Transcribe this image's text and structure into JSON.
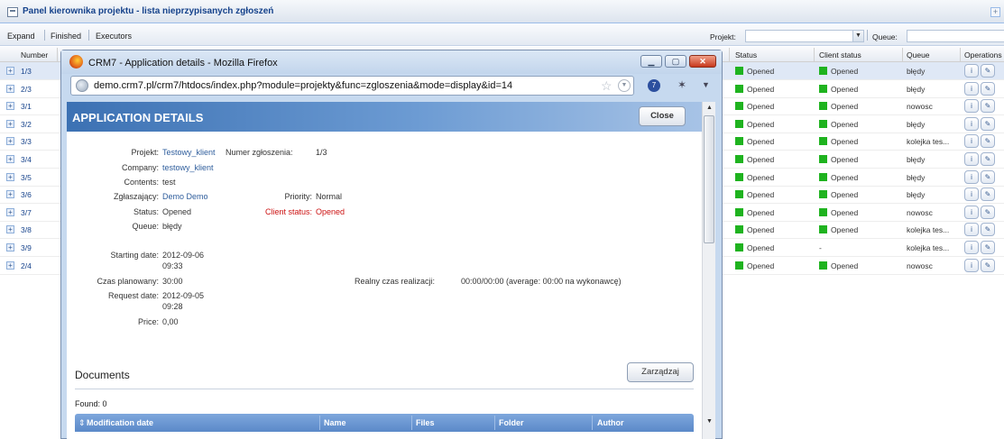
{
  "panel": {
    "title": "Panel kierownika projektu - lista nieprzypisanych zgłoszeń",
    "collapse_symbol": "+"
  },
  "toolbar": {
    "expand": "Expand",
    "finished": "Finished",
    "executors": "Executors",
    "projekt_label": "Projekt:",
    "queue_label": "Queue:"
  },
  "grid": {
    "columns": {
      "number": "Number",
      "status": "Status",
      "client_status": "Client status",
      "queue": "Queue",
      "operations": "Operations"
    },
    "rows": [
      {
        "number": "1/3",
        "status": "Opened",
        "client_status": "Opened",
        "queue": "błędy",
        "selected": true
      },
      {
        "number": "2/3",
        "status": "Opened",
        "client_status": "Opened",
        "queue": "błędy"
      },
      {
        "number": "3/1",
        "status": "Opened",
        "client_status": "Opened",
        "queue": "nowosc"
      },
      {
        "number": "3/2",
        "status": "Opened",
        "client_status": "Opened",
        "queue": "błędy"
      },
      {
        "number": "3/3",
        "status": "Opened",
        "client_status": "Opened",
        "queue": "kolejka tes..."
      },
      {
        "number": "3/4",
        "status": "Opened",
        "client_status": "Opened",
        "queue": "błędy"
      },
      {
        "number": "3/5",
        "status": "Opened",
        "client_status": "Opened",
        "queue": "błędy"
      },
      {
        "number": "3/6",
        "status": "Opened",
        "client_status": "Opened",
        "queue": "błędy"
      },
      {
        "number": "3/7",
        "status": "Opened",
        "client_status": "Opened",
        "queue": "nowosc"
      },
      {
        "number": "3/8",
        "status": "Opened",
        "client_status": "Opened",
        "queue": "kolejka tes..."
      },
      {
        "number": "3/9",
        "status": "Opened",
        "client_status": "-",
        "queue": "kolejka tes..."
      },
      {
        "number": "2/4",
        "status": "Opened",
        "client_status": "Opened",
        "queue": "nowosc"
      }
    ]
  },
  "popup": {
    "window_title": "CRM7 - Application details - Mozilla Firefox",
    "url": "demo.crm7.pl/crm7/htdocs/index.php?module=projekty&func=zgloszenia&mode=display&id=14",
    "app_title": "APPLICATION DETAILS",
    "close_label": "Close",
    "details": {
      "projekt_label": "Projekt:",
      "projekt_value": "Testowy_klient",
      "numer_label": "Numer zgłoszenia:",
      "numer_value": "1/3",
      "company_label": "Company:",
      "company_value": "testowy_klient",
      "contents_label": "Contents:",
      "contents_value": "test",
      "zglaszajacy_label": "Zgłaszający:",
      "zglaszajacy_value": "Demo Demo",
      "priority_label": "Priority:",
      "priority_value": "Normal",
      "status_label": "Status:",
      "status_value": "Opened",
      "client_status_label": "Client status:",
      "client_status_value": "Opened",
      "queue_label": "Queue:",
      "queue_value": "błędy",
      "starting_label": "Starting date:",
      "starting_date": "2012-09-06",
      "starting_time": "09:33",
      "czas_label": "Czas planowany:",
      "czas_value": "30:00",
      "realny_label": "Realny czas realizacji:",
      "realny_value": "00:00/00:00 (average: 00:00 na wykonawcę)",
      "request_label": "Request date:",
      "request_date": "2012-09-05",
      "request_time": "09:28",
      "price_label": "Price:",
      "price_value": "0,00"
    },
    "documents": {
      "title": "Documents",
      "manage_label": "Zarządzaj",
      "found": "Found: 0",
      "columns": {
        "modification_date": "Modification date",
        "name": "Name",
        "files": "Files",
        "folder": "Folder",
        "author": "Author"
      }
    }
  },
  "colors": {
    "status_green": "#1fb31f",
    "header_blue": "#3c71b3",
    "client_status_red": "#cc1111"
  }
}
